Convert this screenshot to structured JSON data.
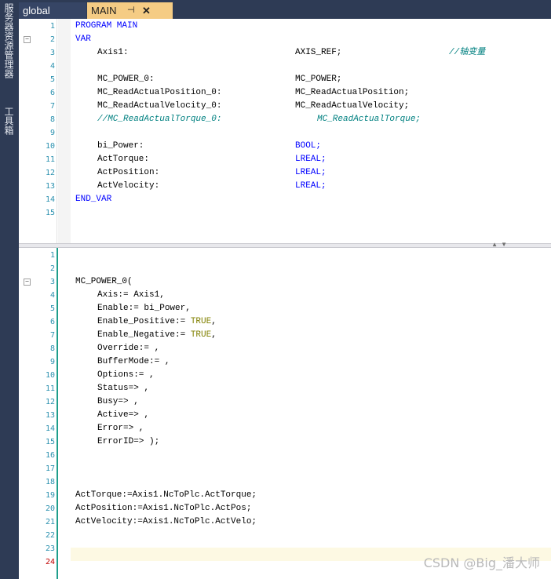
{
  "sidebar": {
    "tabs": [
      "服务器资源管理器",
      "工具箱"
    ]
  },
  "tabs": {
    "global": "global",
    "main": "MAIN",
    "pin_icon": "pin-icon",
    "close_icon": "close-icon"
  },
  "decl": {
    "line_numbers": [
      "1",
      "2",
      "3",
      "4",
      "5",
      "6",
      "7",
      "8",
      "9",
      "10",
      "11",
      "12",
      "13",
      "14",
      "15"
    ],
    "program": "PROGRAM MAIN",
    "var": "VAR",
    "vars": [
      {
        "line": 3,
        "name": "Axis1:",
        "type": "AXIS_REF;",
        "comment": "//轴变量"
      },
      {
        "line": 5,
        "name": "MC_POWER_0:",
        "type": "MC_POWER;"
      },
      {
        "line": 6,
        "name": "MC_ReadActualPosition_0:",
        "type": "MC_ReadActualPosition;"
      },
      {
        "line": 7,
        "name": "MC_ReadActualVelocity_0:",
        "type": "MC_ReadActualVelocity;"
      },
      {
        "line": 8,
        "name": "//MC_ReadActualTorque_0:",
        "type": "MC_ReadActualTorque;",
        "commented": true
      },
      {
        "line": 10,
        "name": "bi_Power:",
        "type": "BOOL;"
      },
      {
        "line": 11,
        "name": "ActTorque:",
        "type": "LREAL;"
      },
      {
        "line": 12,
        "name": "ActPosition:",
        "type": "LREAL;"
      },
      {
        "line": 13,
        "name": "ActVelocity:",
        "type": "LREAL;"
      }
    ],
    "end_var": "END_VAR"
  },
  "body": {
    "line_numbers": [
      "1",
      "2",
      "3",
      "4",
      "5",
      "6",
      "7",
      "8",
      "9",
      "10",
      "11",
      "12",
      "13",
      "14",
      "15",
      "16",
      "17",
      "18",
      "19",
      "20",
      "21",
      "22",
      "23",
      "24"
    ],
    "current_line": "24",
    "lines": {
      "l3": "MC_POWER_0(",
      "l4": "Axis:= Axis1,",
      "l5": "Enable:= bi_Power,",
      "l6a": "Enable_Positive:= ",
      "l6b": "TRUE",
      "l6c": ",",
      "l7a": "Enable_Negative:= ",
      "l7b": "TRUE",
      "l7c": ",",
      "l8": "Override:= ,",
      "l9": "BufferMode:= ,",
      "l10": "Options:= ,",
      "l11": "Status=> ,",
      "l12": "Busy=> ,",
      "l13": "Active=> ,",
      "l14": "Error=> ,",
      "l15": "ErrorID=> );",
      "l19": "ActTorque:=Axis1.NcToPlc.ActTorque;",
      "l20": "ActPosition:=Axis1.NcToPlc.ActPos;",
      "l21": "ActVelocity:=Axis1.NcToPlc.ActVelo;"
    }
  },
  "watermark": "CSDN @Big_潘大师",
  "colors": {
    "keyword": "#0000ff",
    "comment": "#008080",
    "literal": "#808000",
    "line_number": "#2b91af",
    "tab_active": "#f5cc84",
    "chrome": "#2e3b55"
  }
}
